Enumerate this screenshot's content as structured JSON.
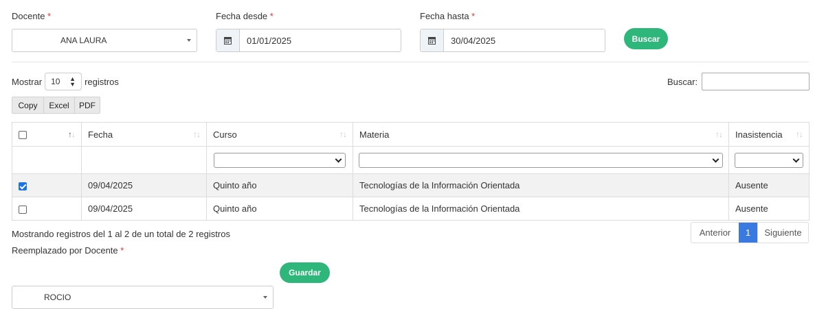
{
  "filters": {
    "docente": {
      "label": "Docente",
      "required_mark": "*",
      "value": "ANA LAURA"
    },
    "fecha_desde": {
      "label": "Fecha desde",
      "required_mark": "*",
      "value": "01/01/2025"
    },
    "fecha_hasta": {
      "label": "Fecha hasta",
      "required_mark": "*",
      "value": "30/04/2025"
    },
    "search_button": "Buscar"
  },
  "datatable": {
    "length_prefix": "Mostrar",
    "length_value": "10",
    "length_suffix": "registros",
    "search_label": "Buscar:",
    "search_value": "",
    "export_buttons": [
      "Copy",
      "Excel",
      "PDF"
    ],
    "columns": [
      "",
      "Fecha",
      "Curso",
      "Materia",
      "Inasistencia"
    ],
    "rows": [
      {
        "checked": true,
        "fecha": "09/04/2025",
        "curso": "Quinto año",
        "materia": "Tecnologías de la Información Orientada",
        "inasistencia": "Ausente"
      },
      {
        "checked": false,
        "fecha": "09/04/2025",
        "curso": "Quinto año",
        "materia": "Tecnologías de la Información Orientada",
        "inasistencia": "Ausente"
      }
    ],
    "info": "Mostrando registros del 1 al 2 de un total de 2 registros",
    "pagination": {
      "prev": "Anterior",
      "current": "1",
      "next": "Siguiente"
    }
  },
  "replacement": {
    "label": "Reemplazado por Docente",
    "required_mark": "*",
    "value": "ROCIO",
    "save_button": "Guardar"
  },
  "colors": {
    "accent_green": "#2fb67a",
    "page_active": "#3a7ae0",
    "required": "#e3342f"
  }
}
